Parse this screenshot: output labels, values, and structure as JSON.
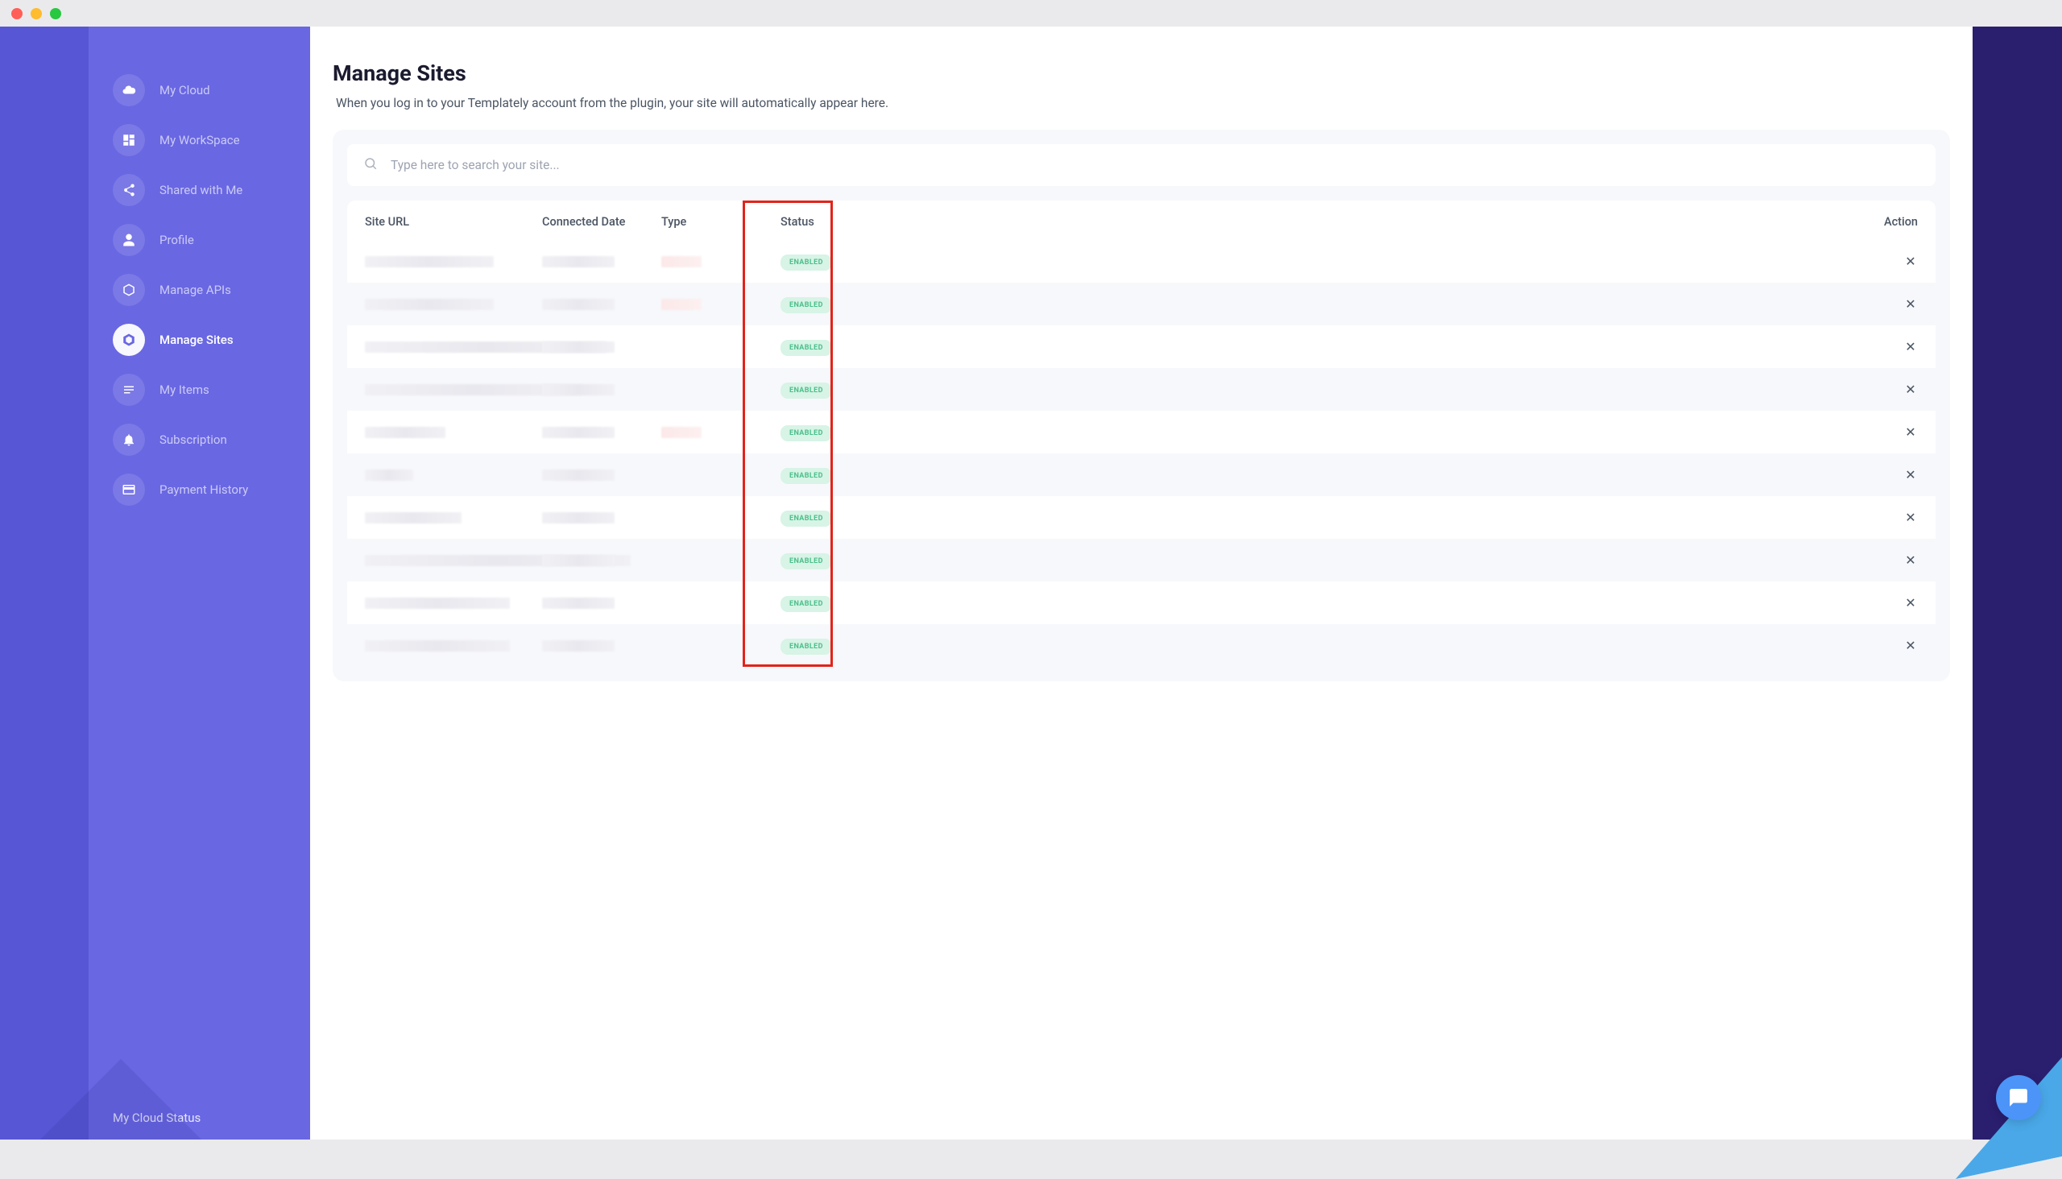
{
  "sidebar": {
    "items": [
      {
        "label": "My Cloud",
        "icon": "cloud"
      },
      {
        "label": "My WorkSpace",
        "icon": "workspace"
      },
      {
        "label": "Shared with Me",
        "icon": "share"
      },
      {
        "label": "Profile",
        "icon": "user"
      },
      {
        "label": "Manage APIs",
        "icon": "api"
      },
      {
        "label": "Manage Sites",
        "icon": "sites",
        "active": true
      },
      {
        "label": "My Items",
        "icon": "items"
      },
      {
        "label": "Subscription",
        "icon": "bell"
      },
      {
        "label": "Payment History",
        "icon": "card"
      }
    ],
    "footer": "My Cloud Status"
  },
  "page": {
    "title": "Manage Sites",
    "subtitle": "When you log in to your Templately account from the plugin, your site will automatically appear here."
  },
  "search": {
    "placeholder": "Type here to search your site..."
  },
  "table": {
    "headers": {
      "url": "Site URL",
      "date": "Connected Date",
      "type": "Type",
      "status": "Status",
      "action": "Action"
    }
  },
  "rows": [
    {
      "status": "ENABLED"
    },
    {
      "status": "ENABLED"
    },
    {
      "status": "ENABLED"
    },
    {
      "status": "ENABLED"
    },
    {
      "status": "ENABLED"
    },
    {
      "status": "ENABLED"
    },
    {
      "status": "ENABLED"
    },
    {
      "status": "ENABLED"
    },
    {
      "status": "ENABLED"
    },
    {
      "status": "ENABLED"
    }
  ]
}
